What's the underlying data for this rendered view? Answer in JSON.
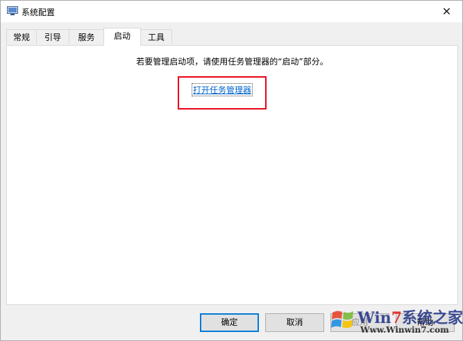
{
  "window": {
    "title": "系统配置",
    "close_glyph": "✕"
  },
  "tabs": [
    {
      "label": "常规",
      "active": false
    },
    {
      "label": "引导",
      "active": false
    },
    {
      "label": "服务",
      "active": false
    },
    {
      "label": "启动",
      "active": true
    },
    {
      "label": "工具",
      "active": false
    }
  ],
  "startup_panel": {
    "info_text": "若要管理启动项，请使用任务管理器的“启动”部分。",
    "link_text": "打开任务管理器"
  },
  "buttons": {
    "ok": "确定",
    "cancel": "取消",
    "apply": "应用",
    "help": "帮助"
  },
  "watermark": {
    "brand_pre": "Win",
    "brand_seven": "7",
    "brand_post": "系统之家",
    "url": "Www.Winwin7.com"
  },
  "colors": {
    "highlight": "#e60012",
    "link": "#0066cc",
    "primary_border": "#0078d7"
  }
}
